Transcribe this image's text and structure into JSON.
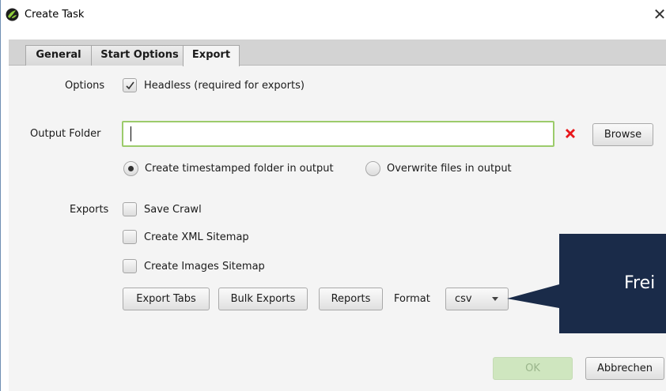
{
  "window": {
    "title": "Create Task",
    "close_icon": "close-icon"
  },
  "tabs": [
    {
      "label": "General",
      "active": false
    },
    {
      "label": "Start Options",
      "active": false
    },
    {
      "label": "Export",
      "active": true
    }
  ],
  "options": {
    "label": "Options",
    "headless_label": "Headless (required for exports)",
    "headless_checked": true
  },
  "output": {
    "label": "Output Folder",
    "value": "",
    "error_icon": "red-x-error-icon",
    "browse_label": "Browse",
    "radio_timestamp_label": "Create timestamped folder in output",
    "radio_timestamp_selected": true,
    "radio_overwrite_label": "Overwrite files in output",
    "radio_overwrite_selected": false
  },
  "exports": {
    "label": "Exports",
    "items": [
      {
        "label": "Save Crawl",
        "checked": false
      },
      {
        "label": "Create XML Sitemap",
        "checked": false
      },
      {
        "label": "Create Images Sitemap",
        "checked": false
      }
    ],
    "export_tabs_label": "Export Tabs",
    "bulk_exports_label": "Bulk Exports",
    "reports_label": "Reports",
    "format_label": "Format",
    "format_value": "csv"
  },
  "footer": {
    "ok_label": "OK",
    "cancel_label": "Abbrechen"
  },
  "callout": {
    "text": "Frei",
    "color": "#1a2b49"
  },
  "colors": {
    "focus_border": "#9ccb6b",
    "error": "#e8171b",
    "ok_disabled": "#cfe6bf"
  }
}
